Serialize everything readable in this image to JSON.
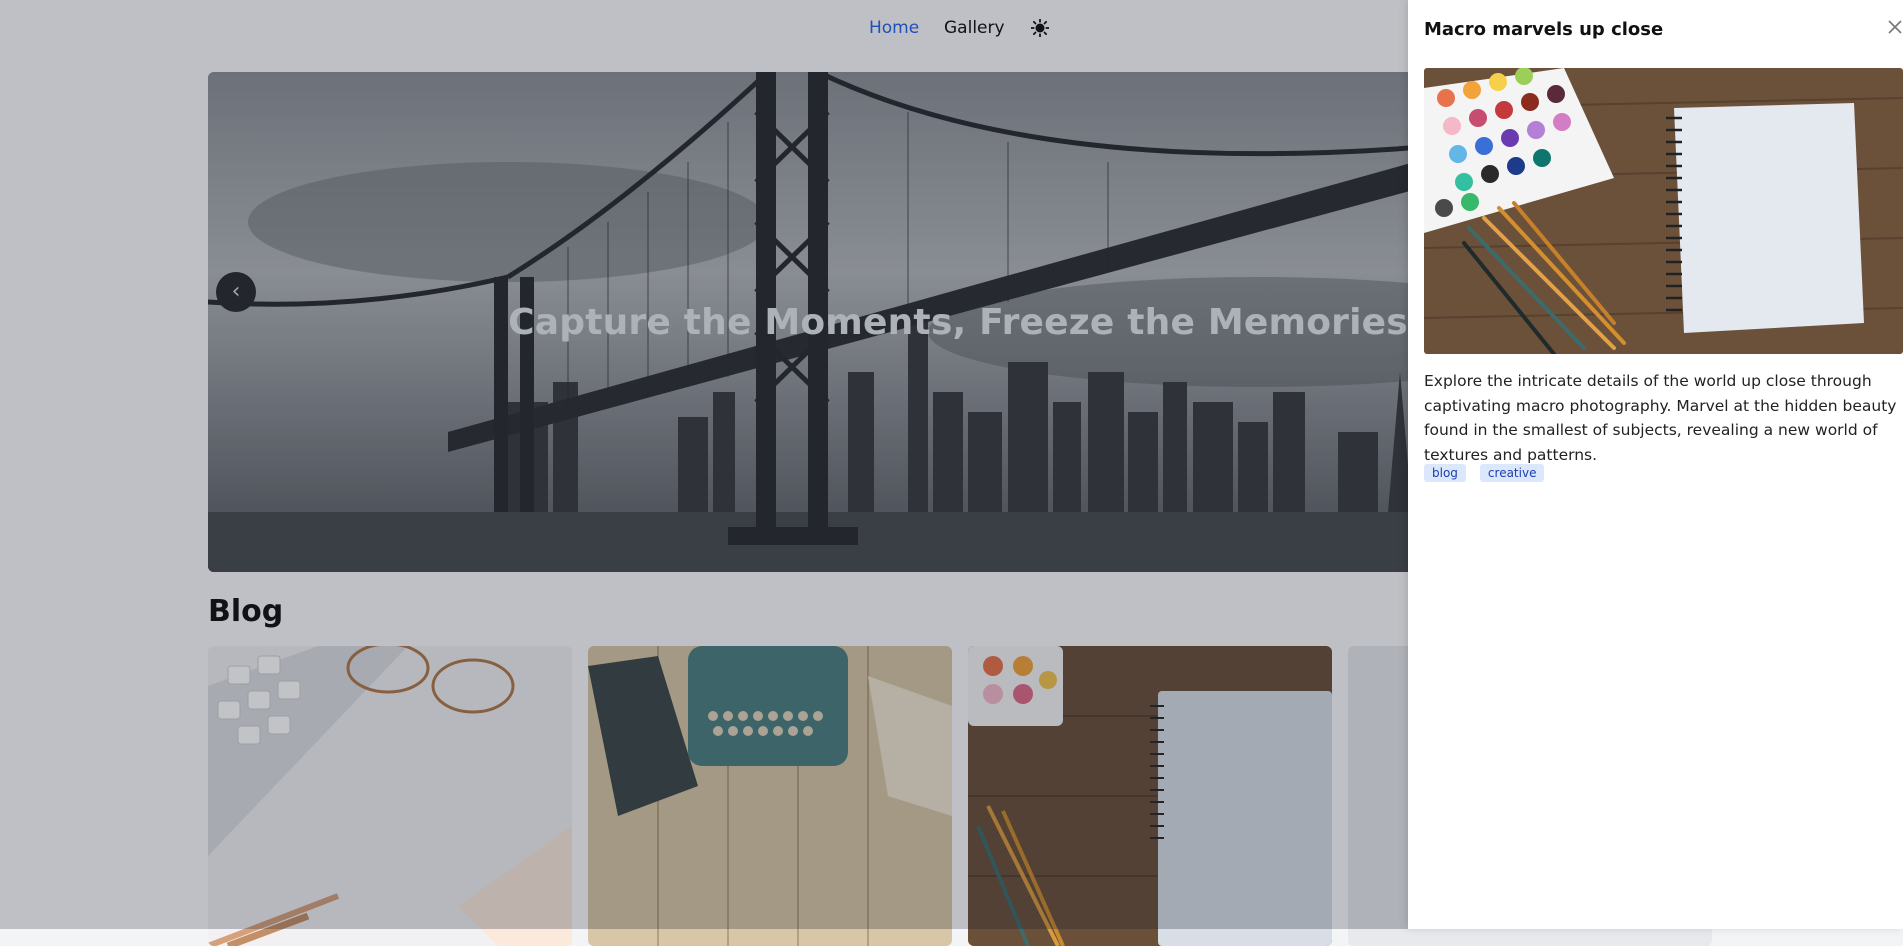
{
  "nav": {
    "home_label": "Home",
    "gallery_label": "Gallery",
    "theme_icon": "sun-icon"
  },
  "hero": {
    "title": "Capture the Moments, Freeze the Memories",
    "prev_icon": "chevron-left-icon"
  },
  "blog": {
    "title": "Blog",
    "cards": [
      {
        "image": "desk-keyboard-glasses-image"
      },
      {
        "image": "typewriter-image"
      },
      {
        "image": "watercolor-notebook-image"
      },
      {
        "image": "partial-card-image"
      }
    ]
  },
  "drawer": {
    "title": "Macro marvels up close",
    "close_icon": "close-icon",
    "description": "Explore the intricate details of the world up close through captivating macro photography. Marvel at the hidden beauty found in the smallest of subjects, revealing a new world of textures and patterns.",
    "tags": [
      "blog",
      "creative"
    ]
  },
  "colors": {
    "accent": "#2563eb",
    "tag_bg": "#dbe7fb",
    "tag_text": "#1e40af",
    "overlay": "#111827"
  }
}
